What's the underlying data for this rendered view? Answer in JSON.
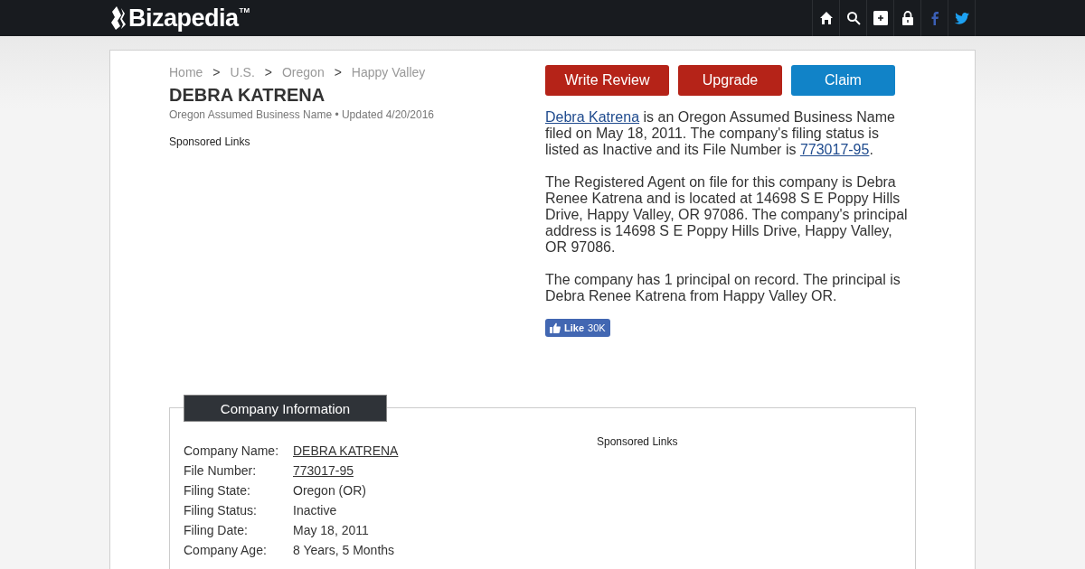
{
  "header": {
    "logo": "Bizapedia",
    "trademark": "TM",
    "nav_icons": [
      {
        "kind": "home"
      },
      {
        "kind": "search"
      },
      {
        "kind": "add"
      },
      {
        "kind": "lock"
      },
      {
        "kind": "facebook"
      },
      {
        "kind": "twitter"
      }
    ]
  },
  "breadcrumbs": [
    {
      "label": "Home"
    },
    {
      "label": "U.S."
    },
    {
      "label": "Oregon"
    },
    {
      "label": "Happy Valley"
    }
  ],
  "breadcrumb_separator": ">",
  "title": "DEBRA KATRENA",
  "subtitle": "Oregon Assumed Business Name • Updated 4/20/2016",
  "sponsored_label": "Sponsored Links",
  "actions": [
    {
      "label": "Write Review",
      "kind": "primary"
    },
    {
      "label": "Upgrade",
      "kind": "primary"
    },
    {
      "label": "Claim",
      "kind": "info"
    }
  ],
  "paragraphs": [
    [
      {
        "text": "Debra Katrena",
        "link": true
      },
      {
        "text": " is an Oregon Assumed Business Name filed on May 18, 2011. The company's filing status is listed as Inactive and its File Number is ",
        "link": false
      },
      {
        "text": "773017-95",
        "link": true
      },
      {
        "text": ".",
        "link": false
      }
    ],
    [
      {
        "text": "The Registered Agent on file for this company is Debra Renee Katrena and is located at 14698 S E Poppy Hills Drive, Happy Valley, OR 97086. The company's principal address is 14698 S E Poppy Hills Drive, Happy Valley, OR 97086.",
        "link": false
      }
    ],
    [
      {
        "text": "The company has 1 principal on record. The principal is Debra Renee Katrena from Happy Valley OR.",
        "link": false
      }
    ]
  ],
  "like_button": {
    "label": "Like",
    "count": "30K"
  },
  "company_info": {
    "title": "Company Information",
    "sponsored_label": "Sponsored Links",
    "rows": [
      {
        "label": "Company Name:",
        "value": "DEBRA KATRENA",
        "link": true
      },
      {
        "label": "File Number:",
        "value": "773017-95",
        "link": true
      },
      {
        "label": "Filing State:",
        "value": "Oregon (OR)",
        "link": false
      },
      {
        "label": "Filing Status:",
        "value": "Inactive",
        "link": false
      },
      {
        "label": "Filing Date:",
        "value": "May 18, 2011",
        "link": false
      },
      {
        "label": "Company Age:",
        "value": "8 Years, 5 Months",
        "link": false
      }
    ]
  }
}
